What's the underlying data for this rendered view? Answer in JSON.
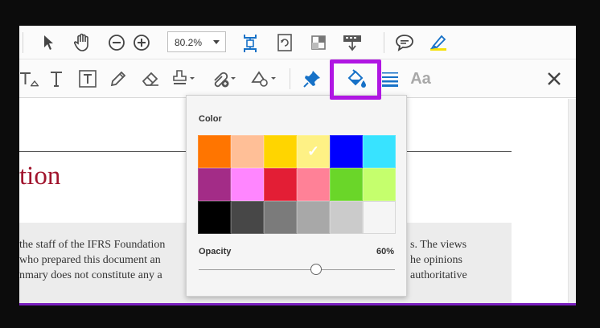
{
  "toolbar": {
    "zoom_value": "80.2%",
    "tools_row1": [
      "select-tool",
      "hand-tool",
      "zoom-out",
      "zoom-in",
      "zoom-level",
      "fit-page",
      "rotate-page",
      "full-screen",
      "stamp-print",
      "comment",
      "highlight-pen"
    ],
    "tools_row2": [
      "text-callout",
      "add-text",
      "text-box",
      "pencil",
      "eraser",
      "stamp",
      "attach",
      "shapes",
      "pin",
      "fill-color",
      "line-width",
      "font-properties",
      "close"
    ],
    "font_label": "Aa"
  },
  "document": {
    "title_fragment": "tion",
    "lines": [
      "the staff of the IFRS Foundation",
      "who prepared this document an",
      "nmary does not constitute any a"
    ],
    "lines_right": [
      "s.  The views",
      "he opinions",
      "authoritative"
    ]
  },
  "popup": {
    "color_label": "Color",
    "opacity_label": "Opacity",
    "opacity_value": "60%",
    "opacity_fraction": 0.6,
    "swatches": [
      "#ff7500",
      "#ffbf97",
      "#ffd500",
      "#fef185",
      "#0000ff",
      "#38e3ff",
      "#a32c87",
      "#ff86ff",
      "#e31e35",
      "#ff8197",
      "#6ad629",
      "#c5ff6d",
      "#000000",
      "#474747",
      "#7b7b7b",
      "#a8a8a8",
      "#cbcbcb",
      "#f5f5f5"
    ],
    "selected_index": 3,
    "check_glyph": "✓"
  },
  "colors": {
    "highlight_border": "#b016e3",
    "accent_blue": "#1671c7",
    "title_red": "#a1142d"
  }
}
